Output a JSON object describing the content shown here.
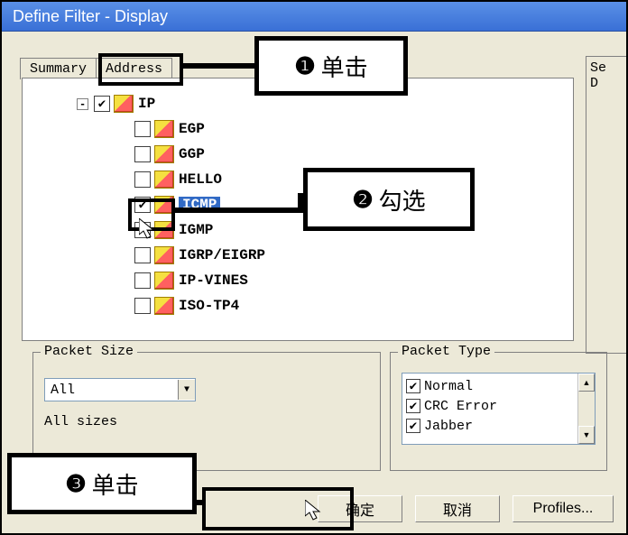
{
  "window": {
    "title": "Define Filter - Display"
  },
  "tabs": {
    "summary": "Summary",
    "address": "Address"
  },
  "right": {
    "line1": "Se",
    "line2": "D"
  },
  "tree": {
    "root": {
      "label": "IP",
      "checked": true
    },
    "children": [
      {
        "label": "EGP",
        "checked": false
      },
      {
        "label": "GGP",
        "checked": false
      },
      {
        "label": "HELLO",
        "checked": false
      },
      {
        "label": "ICMP",
        "checked": true,
        "selected": true
      },
      {
        "label": "IGMP",
        "checked": false
      },
      {
        "label": "IGRP/EIGRP",
        "checked": false
      },
      {
        "label": "IP-VINES",
        "checked": false
      },
      {
        "label": "ISO-TP4",
        "checked": false
      }
    ]
  },
  "packet_size": {
    "legend": "Packet Size",
    "combo": "All",
    "label": "All sizes"
  },
  "packet_type": {
    "legend": "Packet Type",
    "items": [
      {
        "label": "Normal",
        "checked": true
      },
      {
        "label": "CRC Error",
        "checked": true
      },
      {
        "label": "Jabber",
        "checked": true
      }
    ]
  },
  "buttons": {
    "ok": "确定",
    "cancel": "取消",
    "profiles": "Profiles..."
  },
  "annotations": {
    "c1": {
      "num": "❶",
      "text": "单击"
    },
    "c2": {
      "num": "❷",
      "text": "勾选"
    },
    "c3": {
      "num": "❸",
      "text": "单击"
    }
  }
}
